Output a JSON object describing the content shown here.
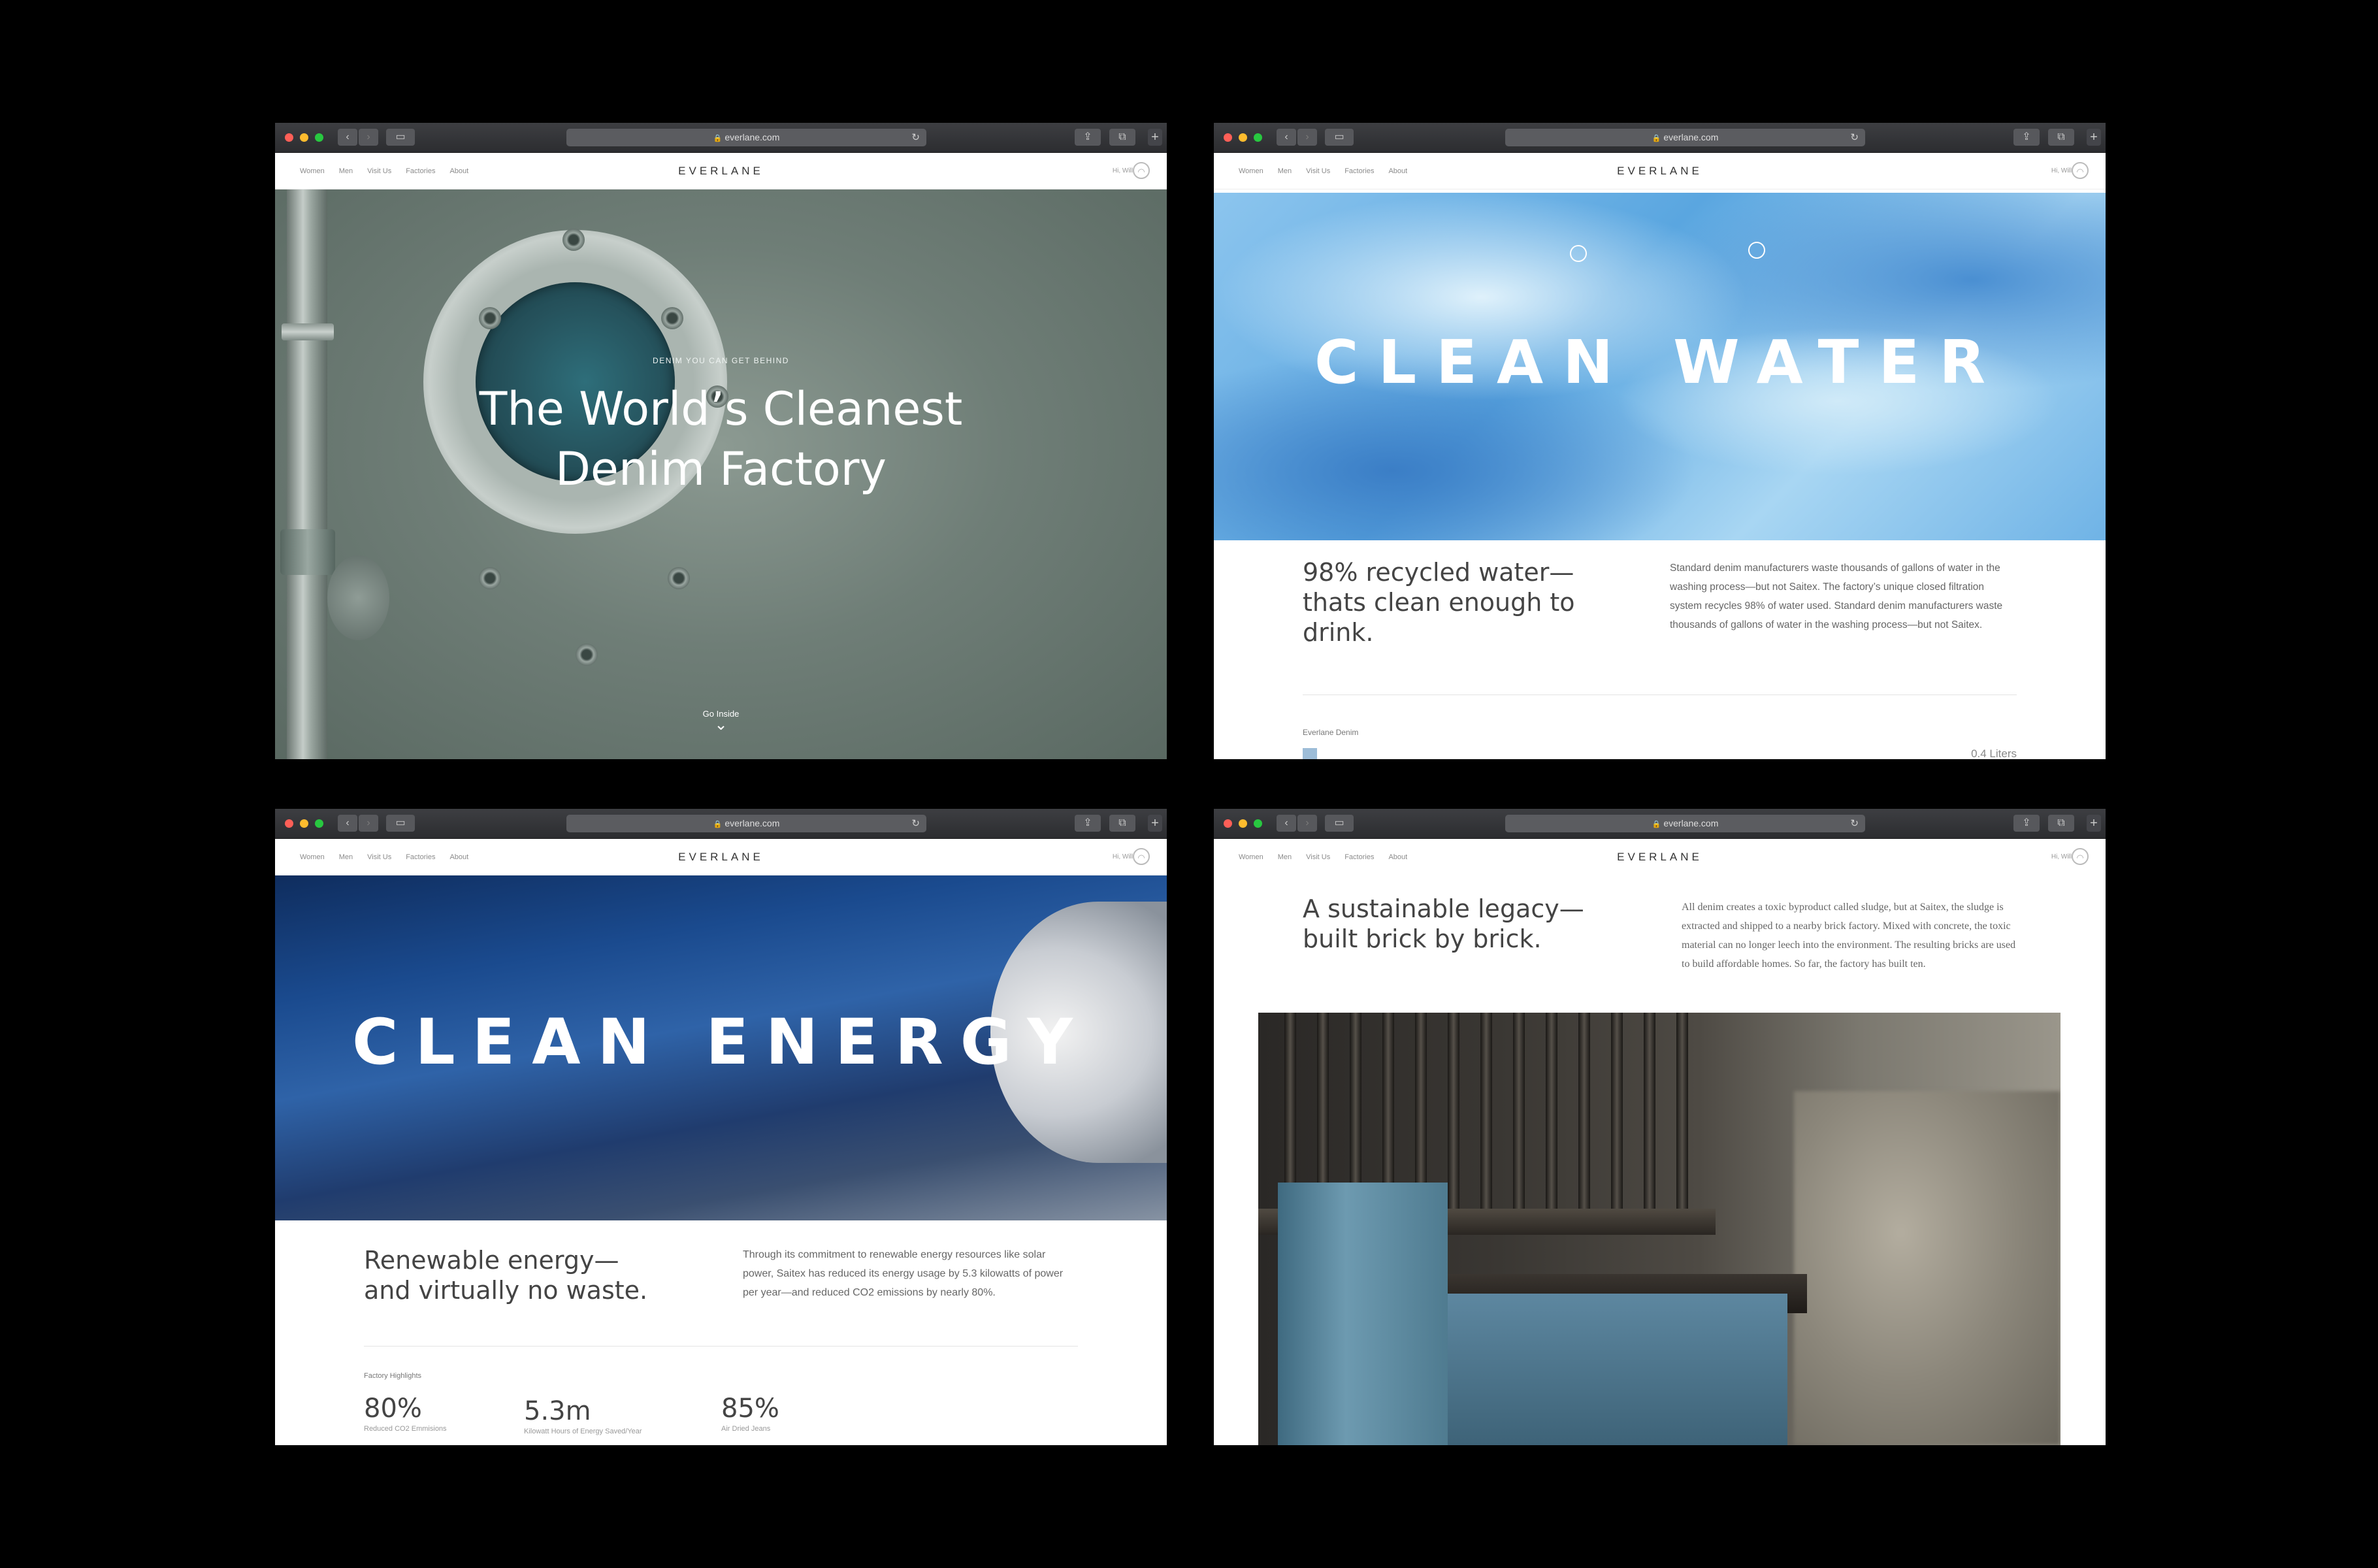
{
  "browser": {
    "url": "everlane.com"
  },
  "site": {
    "nav_links": [
      "Women",
      "Men",
      "Visit Us",
      "Factories",
      "About"
    ],
    "logo": "EVERLANE",
    "greeting": "Hi, Will"
  },
  "screen1": {
    "kicker": "DENIM YOU CAN GET BEHIND",
    "title_line1": "The World’s Cleanest",
    "title_line2": "Denim Factory",
    "go_inside": "Go Inside"
  },
  "screen2": {
    "hero_title": "CLEAN WATER",
    "heading_line1": "98% recycled water—",
    "heading_line2": "thats clean enough to",
    "heading_line3": "drink.",
    "body": "Standard denim manufacturers waste thousands of gallons of water in the washing process—but not Saitex. The factory’s unique closed filtration system recycles 98% of water used. Standard denim manufacturers waste thousands of gallons of water in the washing process—but not Saitex.",
    "bar_label": "Everlane Denim",
    "bar_value": "0.4 Liters"
  },
  "screen3": {
    "hero_title": "CLEAN ENERGY",
    "heading_line1": "Renewable energy—",
    "heading_line2": "and virtually no waste.",
    "body": "Through its commitment to renewable energy resources like solar power, Saitex has reduced its energy usage by 5.3 kilowatts of power per year—and reduced CO2 emissions by nearly 80%.",
    "highlights_label": "Factory Highlights",
    "stats": [
      {
        "value": "80%",
        "label": "Reduced CO2 Emmisions"
      },
      {
        "value": "5.3m",
        "label": "Kilowatt Hours of Energy Saved/Year"
      },
      {
        "value": "85%",
        "label": "Air Dried Jeans"
      }
    ]
  },
  "screen4": {
    "heading_line1": "A sustainable legacy—",
    "heading_line2": "built brick by brick.",
    "body": "All denim creates a toxic byproduct called sludge, but at Saitex, the sludge is extracted and shipped to a nearby brick factory. Mixed with concrete, the toxic material can no longer leech into the environment. The resulting bricks are used to build affordable homes. So far, the factory has built ten."
  }
}
